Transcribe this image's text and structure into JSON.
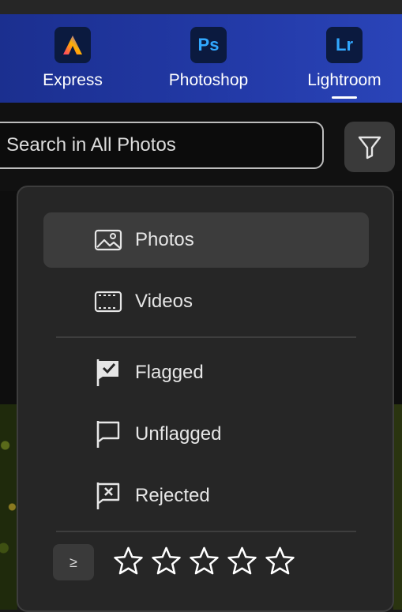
{
  "app_bar": {
    "apps": [
      {
        "name": "Express",
        "tile_text": "A"
      },
      {
        "name": "Photoshop",
        "tile_text": "Ps"
      },
      {
        "name": "Lightroom",
        "tile_text": "Lr",
        "active": true
      }
    ]
  },
  "search": {
    "placeholder": "Search in All Photos",
    "value": ""
  },
  "filter_button": {
    "icon": "filter-funnel-icon"
  },
  "filter_menu": {
    "items": [
      {
        "label": "Photos",
        "icon": "image-icon",
        "selected": true
      },
      {
        "label": "Videos",
        "icon": "film-strip-icon"
      },
      {
        "label": "Flagged",
        "icon": "flag-check-icon"
      },
      {
        "label": "Unflagged",
        "icon": "flag-outline-icon"
      },
      {
        "label": "Rejected",
        "icon": "flag-x-icon"
      }
    ],
    "rating": {
      "operator": "≥",
      "stars_total": 5,
      "stars_filled": 0
    }
  },
  "colors": {
    "app_bar_gradient_start": "#1b2f8f",
    "app_bar_gradient_end": "#2a44b8",
    "menu_bg": "#262626",
    "selected_bg": "#3c3c3c"
  }
}
